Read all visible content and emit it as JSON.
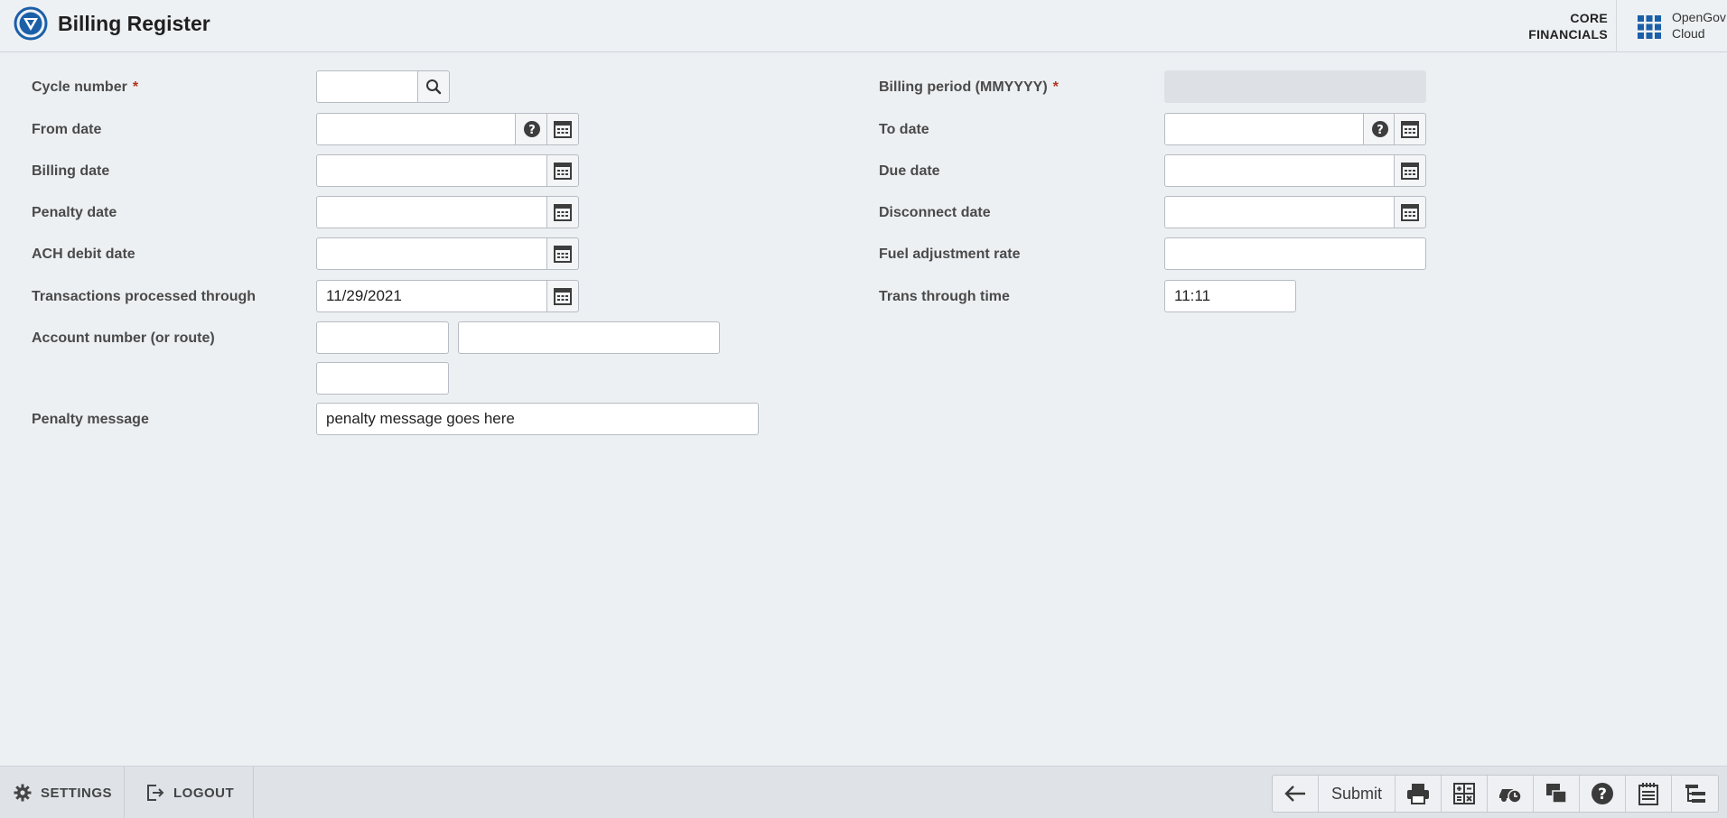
{
  "header": {
    "title": "Billing Register",
    "product_line1": "CORE",
    "product_line2": "FINANCIALS",
    "brand_line1": "OpenGov",
    "brand_line2": "Cloud"
  },
  "form": {
    "cycle_number": {
      "label": "Cycle number",
      "required": "*",
      "value": ""
    },
    "billing_period": {
      "label": "Billing period (MMYYYY)",
      "required": "*",
      "value": ""
    },
    "from_date": {
      "label": "From date",
      "value": ""
    },
    "to_date": {
      "label": "To date",
      "value": ""
    },
    "billing_date": {
      "label": "Billing date",
      "value": ""
    },
    "due_date": {
      "label": "Due date",
      "value": ""
    },
    "penalty_date": {
      "label": "Penalty date",
      "value": ""
    },
    "disconnect_date": {
      "label": "Disconnect date",
      "value": ""
    },
    "ach_debit_date": {
      "label": "ACH debit date",
      "value": ""
    },
    "fuel_adjustment_rate": {
      "label": "Fuel adjustment rate",
      "value": ""
    },
    "transactions_processed_through": {
      "label": "Transactions processed through",
      "value": "11/29/2021"
    },
    "trans_through_time": {
      "label": "Trans through time",
      "value": "11:11"
    },
    "account_number": {
      "label": "Account number (or route)",
      "value1": "",
      "value2": "",
      "value3": ""
    },
    "penalty_message": {
      "label": "Penalty message",
      "value": "penalty message goes here"
    }
  },
  "footer": {
    "settings_label": "SETTINGS",
    "logout_label": "LOGOUT",
    "submit_label": "Submit"
  },
  "colors": {
    "brand_blue": "#1b5fa8",
    "required_red": "#b2341f",
    "background": "#edf0f3"
  }
}
